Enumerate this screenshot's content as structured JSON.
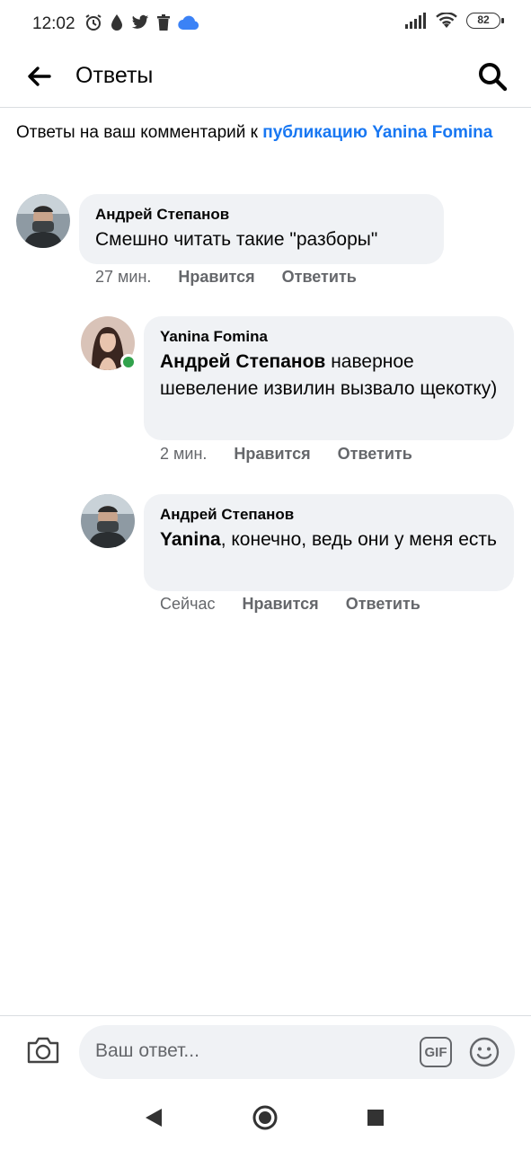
{
  "status_bar": {
    "time": "12:02",
    "battery": "82",
    "icons": [
      "alarm-icon",
      "drop-icon",
      "twitter-icon",
      "trash-icon",
      "cloud-icon",
      "signal-icon",
      "wifi-icon",
      "battery-icon"
    ]
  },
  "header": {
    "title": "Ответы",
    "back_icon": "arrow-left-icon",
    "search_icon": "search-icon"
  },
  "context": {
    "prefix": "Ответы на ваш комментарий к ",
    "link": "публикацию Yanina Fomina"
  },
  "comments": [
    {
      "author": "Андрей Степанов",
      "mention": "",
      "text": "Смешно читать такие \"разборы\"",
      "time": "27 мин.",
      "like": "Нравится",
      "reply": "Ответить"
    },
    {
      "author": "Yanina Fomina",
      "mention": "Андрей Степанов",
      "text": " наверное шевеление извилин вызвало щекотку)",
      "time": "2 мин.",
      "like": "Нравится",
      "reply": "Ответить"
    },
    {
      "author": "Андрей Степанов",
      "mention": "Yanina",
      "text": ", конечно, ведь они у меня есть",
      "time": "Сейчас",
      "like": "Нравится",
      "reply": "Ответить"
    }
  ],
  "composer": {
    "placeholder": "Ваш ответ...",
    "gif_label": "GIF"
  },
  "colors": {
    "link": "#1877f2",
    "bubble": "#f0f2f5",
    "secondary_text": "#65676b",
    "online": "#31a24c"
  }
}
